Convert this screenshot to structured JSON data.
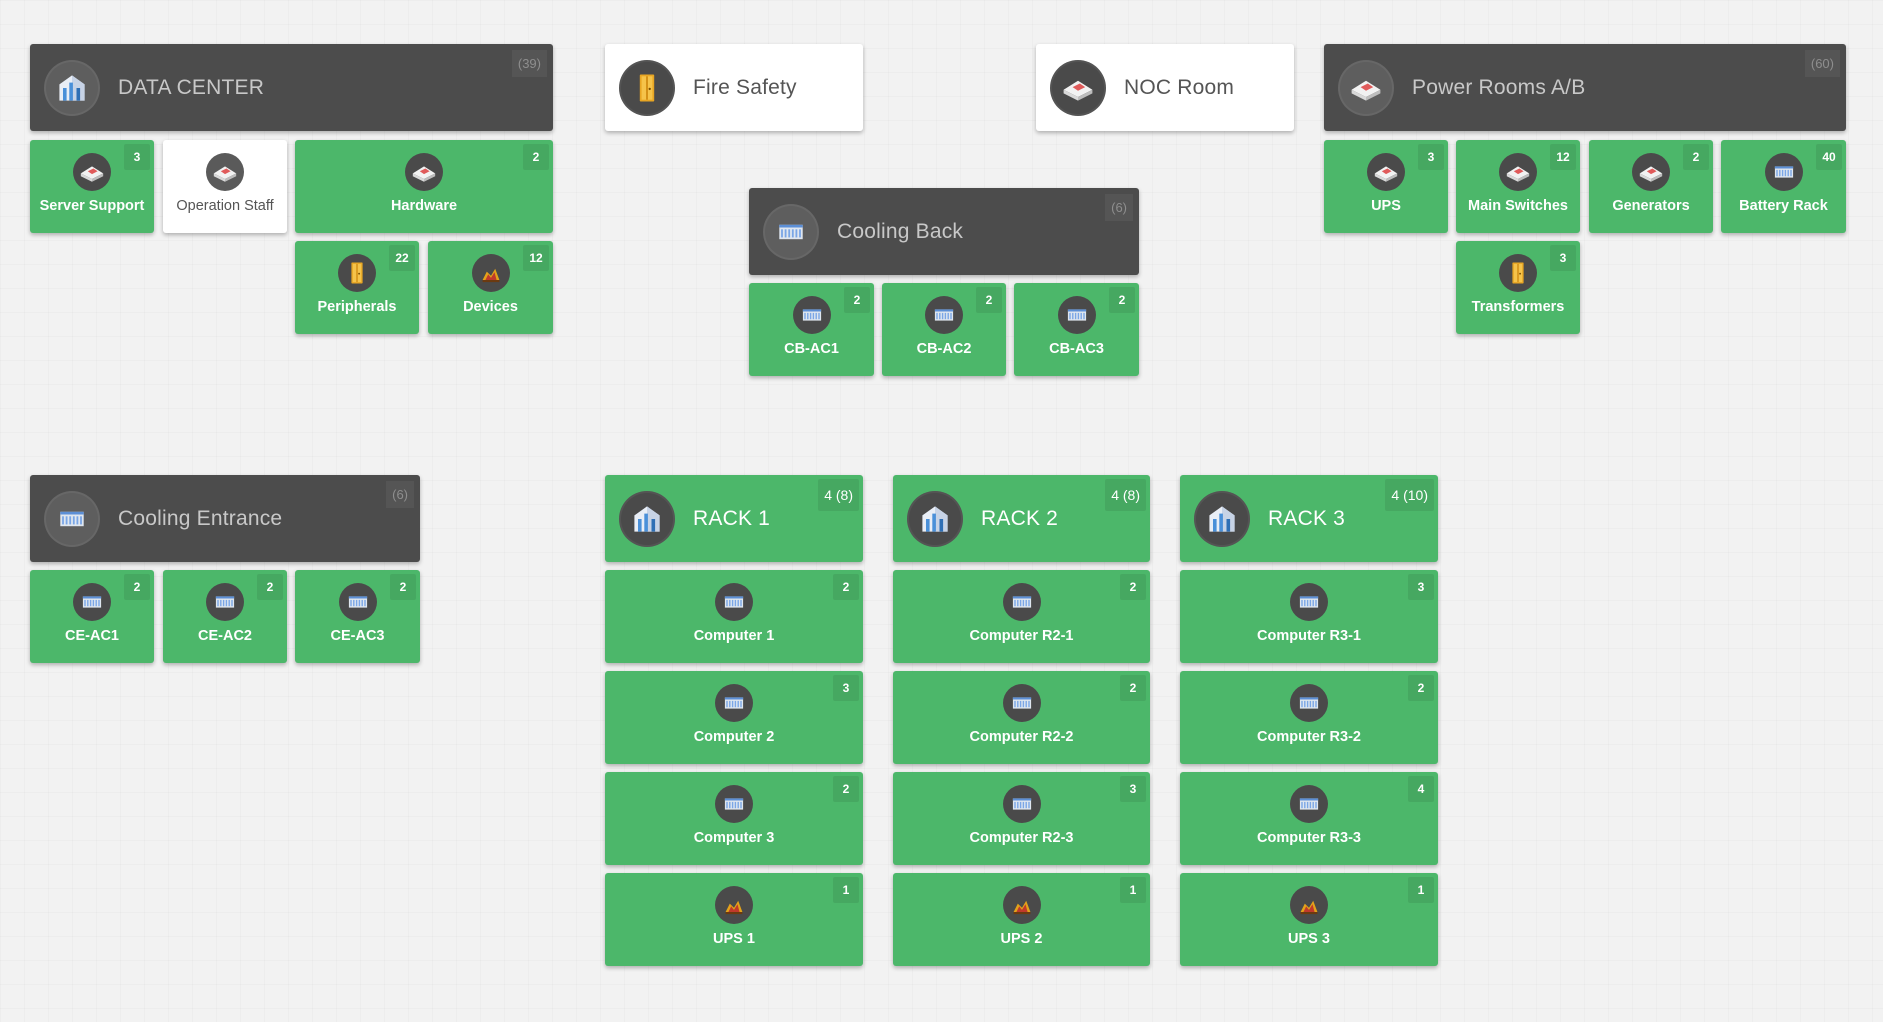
{
  "colors": {
    "green": "#4cb76a",
    "dark_header": "#4c4c4c",
    "white_header": "#ffffff",
    "background": "#f2f2f2"
  },
  "groups": {
    "data_center": {
      "title": "DATA CENTER",
      "count": "(39)",
      "icon": "building-icon",
      "items": [
        {
          "label": "Server Support",
          "count": "3",
          "icon": "house-box-icon"
        },
        {
          "label": "Operation Staff",
          "count": "",
          "icon": "house-box-icon"
        },
        {
          "label": "Hardware",
          "count": "2",
          "icon": "house-box-icon"
        },
        {
          "label": "Peripherals",
          "count": "22",
          "icon": "door-icon"
        },
        {
          "label": "Devices",
          "count": "12",
          "icon": "fire-icon"
        }
      ]
    },
    "fire_safety": {
      "title": "Fire Safety",
      "icon": "door-icon"
    },
    "noc_room": {
      "title": "NOC Room",
      "icon": "house-box-icon"
    },
    "power_rooms": {
      "title": "Power Rooms A/B",
      "count": "(60)",
      "icon": "house-box-icon",
      "items": [
        {
          "label": "UPS",
          "count": "3",
          "icon": "house-box-icon"
        },
        {
          "label": "Main Switches",
          "count": "12",
          "icon": "house-box-icon"
        },
        {
          "label": "Generators",
          "count": "2",
          "icon": "house-box-icon"
        },
        {
          "label": "Battery Rack",
          "count": "40",
          "icon": "server-icon"
        },
        {
          "label": "Transformers",
          "count": "3",
          "icon": "door-icon"
        }
      ]
    },
    "cooling_back": {
      "title": "Cooling Back",
      "count": "(6)",
      "icon": "server-icon",
      "items": [
        {
          "label": "CB-AC1",
          "count": "2",
          "icon": "server-icon"
        },
        {
          "label": "CB-AC2",
          "count": "2",
          "icon": "server-icon"
        },
        {
          "label": "CB-AC3",
          "count": "2",
          "icon": "server-icon"
        }
      ]
    },
    "cooling_entrance": {
      "title": "Cooling Entrance",
      "count": "(6)",
      "icon": "server-icon",
      "items": [
        {
          "label": "CE-AC1",
          "count": "2",
          "icon": "server-icon"
        },
        {
          "label": "CE-AC2",
          "count": "2",
          "icon": "server-icon"
        },
        {
          "label": "CE-AC3",
          "count": "2",
          "icon": "server-icon"
        }
      ]
    },
    "rack1": {
      "title": "RACK 1",
      "count": "4 (8)",
      "icon": "building-icon",
      "items": [
        {
          "label": "Computer 1",
          "count": "2",
          "icon": "server-icon"
        },
        {
          "label": "Computer 2",
          "count": "3",
          "icon": "server-icon"
        },
        {
          "label": "Computer 3",
          "count": "2",
          "icon": "server-icon"
        },
        {
          "label": "UPS 1",
          "count": "1",
          "icon": "fire-icon"
        }
      ]
    },
    "rack2": {
      "title": "RACK 2",
      "count": "4 (8)",
      "icon": "building-icon",
      "items": [
        {
          "label": "Computer R2-1",
          "count": "2",
          "icon": "server-icon"
        },
        {
          "label": "Computer R2-2",
          "count": "2",
          "icon": "server-icon"
        },
        {
          "label": "Computer R2-3",
          "count": "3",
          "icon": "server-icon"
        },
        {
          "label": "UPS 2",
          "count": "1",
          "icon": "fire-icon"
        }
      ]
    },
    "rack3": {
      "title": "RACK 3",
      "count": "4 (10)",
      "icon": "building-icon",
      "items": [
        {
          "label": "Computer R3-1",
          "count": "3",
          "icon": "server-icon"
        },
        {
          "label": "Computer R3-2",
          "count": "2",
          "icon": "server-icon"
        },
        {
          "label": "Computer R3-3",
          "count": "4",
          "icon": "server-icon"
        },
        {
          "label": "UPS 3",
          "count": "1",
          "icon": "fire-icon"
        }
      ]
    }
  }
}
